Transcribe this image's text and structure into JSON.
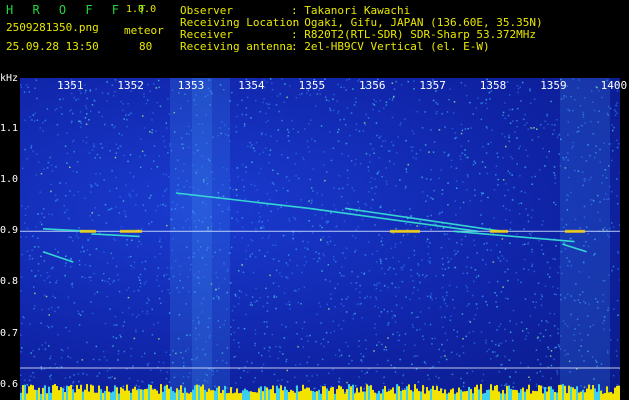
{
  "header": {
    "app_logo": "H R O F F T",
    "app_version": "1.0.0",
    "filename": "2509281350.png",
    "detector_type": "meteor",
    "timestamp": "25.09.28 13:50",
    "meteor_count": "80",
    "fields": [
      {
        "label": "Observer",
        "value": ": Takanori Kawachi"
      },
      {
        "label": "Receiving Location",
        "value": ": Ogaki, Gifu, JAPAN (136.60E, 35.35N)"
      },
      {
        "label": "Receiver",
        "value": ": R820T2(RTL-SDR) SDR-Sharp 53.372MHz"
      },
      {
        "label": "Receiving antenna",
        "value": ": 2el-HB9CV Vertical (el. E-W)"
      }
    ]
  },
  "chart_data": {
    "type": "heatmap",
    "ylabel": "kHz",
    "yticks": [
      "1.1",
      "1.0",
      "0.9",
      "0.8",
      "0.7",
      "0.6"
    ],
    "xticks": [
      "1351",
      "1352",
      "1353",
      "1354",
      "1355",
      "1356",
      "1357",
      "1358",
      "1359",
      "1400"
    ],
    "ylim": [
      0.57,
      1.2
    ],
    "carrier_khz": 0.9,
    "traces": [
      {
        "x": [
          1351.0,
          1351.8
        ],
        "y": [
          0.905,
          0.9
        ]
      },
      {
        "x": [
          1351.8,
          1352.6
        ],
        "y": [
          0.895,
          0.89
        ]
      },
      {
        "x": [
          1353.2,
          1355.4
        ],
        "y": [
          0.975,
          0.945
        ]
      },
      {
        "x": [
          1355.4,
          1358.2
        ],
        "y": [
          0.945,
          0.9
        ]
      },
      {
        "x": [
          1356.0,
          1358.6
        ],
        "y": [
          0.945,
          0.9
        ]
      },
      {
        "x": [
          1357.8,
          1359.8
        ],
        "y": [
          0.9,
          0.88
        ]
      },
      {
        "x": [
          1351.0,
          1351.5
        ],
        "y": [
          0.86,
          0.84
        ]
      },
      {
        "x": [
          1359.6,
          1400.0
        ],
        "y": [
          0.875,
          0.86
        ]
      }
    ],
    "colors": {
      "background": "#0f23a6",
      "trace": "#39e6d6",
      "hot": "#ffd400",
      "carrier": "#d7e8ff"
    }
  }
}
